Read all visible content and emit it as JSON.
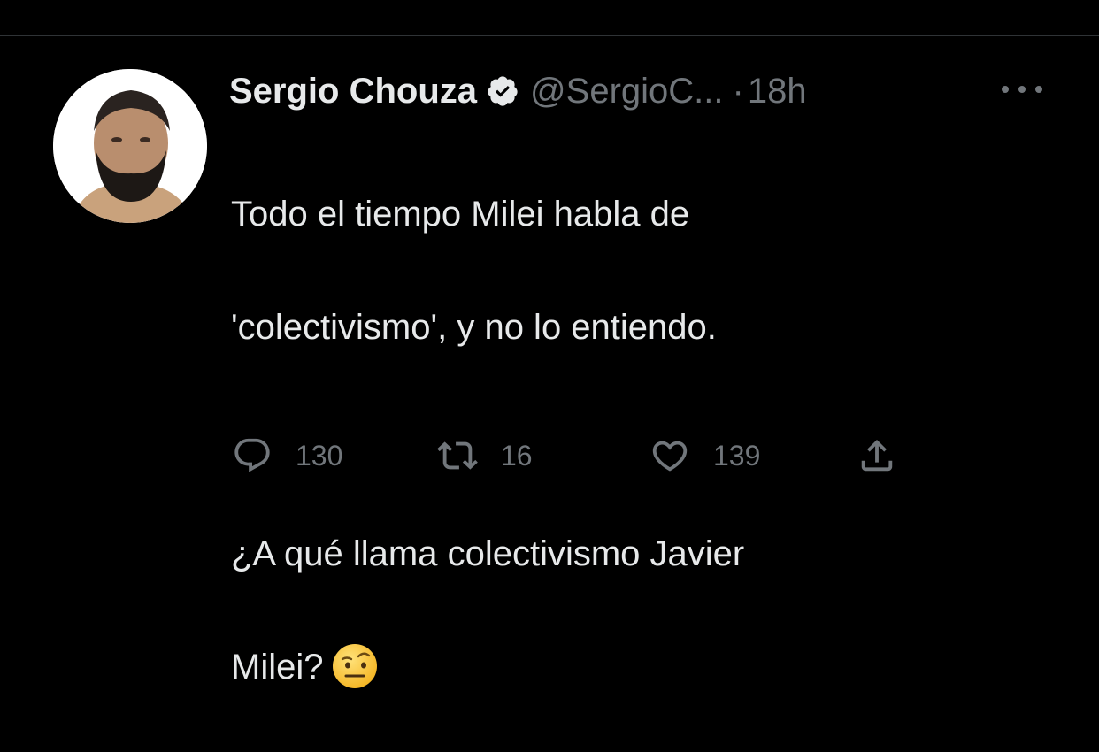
{
  "tweet": {
    "author_name": "Sergio Chouza",
    "handle": "@SergioC...",
    "separator": "·",
    "time": "18h",
    "text_lines": [
      "Todo el tiempo Milei habla de",
      "'colectivismo', y no lo entiendo.",
      "¿A qué llama colectivismo Javier",
      "Milei?"
    ],
    "verified": true,
    "emoji": "raised-eyebrow-face"
  },
  "actions": {
    "reply_count": "130",
    "retweet_count": "16",
    "like_count": "139"
  },
  "icons": {
    "verified": "verified-badge-icon",
    "more": "more-icon",
    "reply": "reply-icon",
    "retweet": "retweet-icon",
    "like": "heart-icon",
    "share": "share-icon"
  },
  "colors": {
    "background": "#000000",
    "text": "#e7e9ea",
    "muted": "#71767b"
  }
}
